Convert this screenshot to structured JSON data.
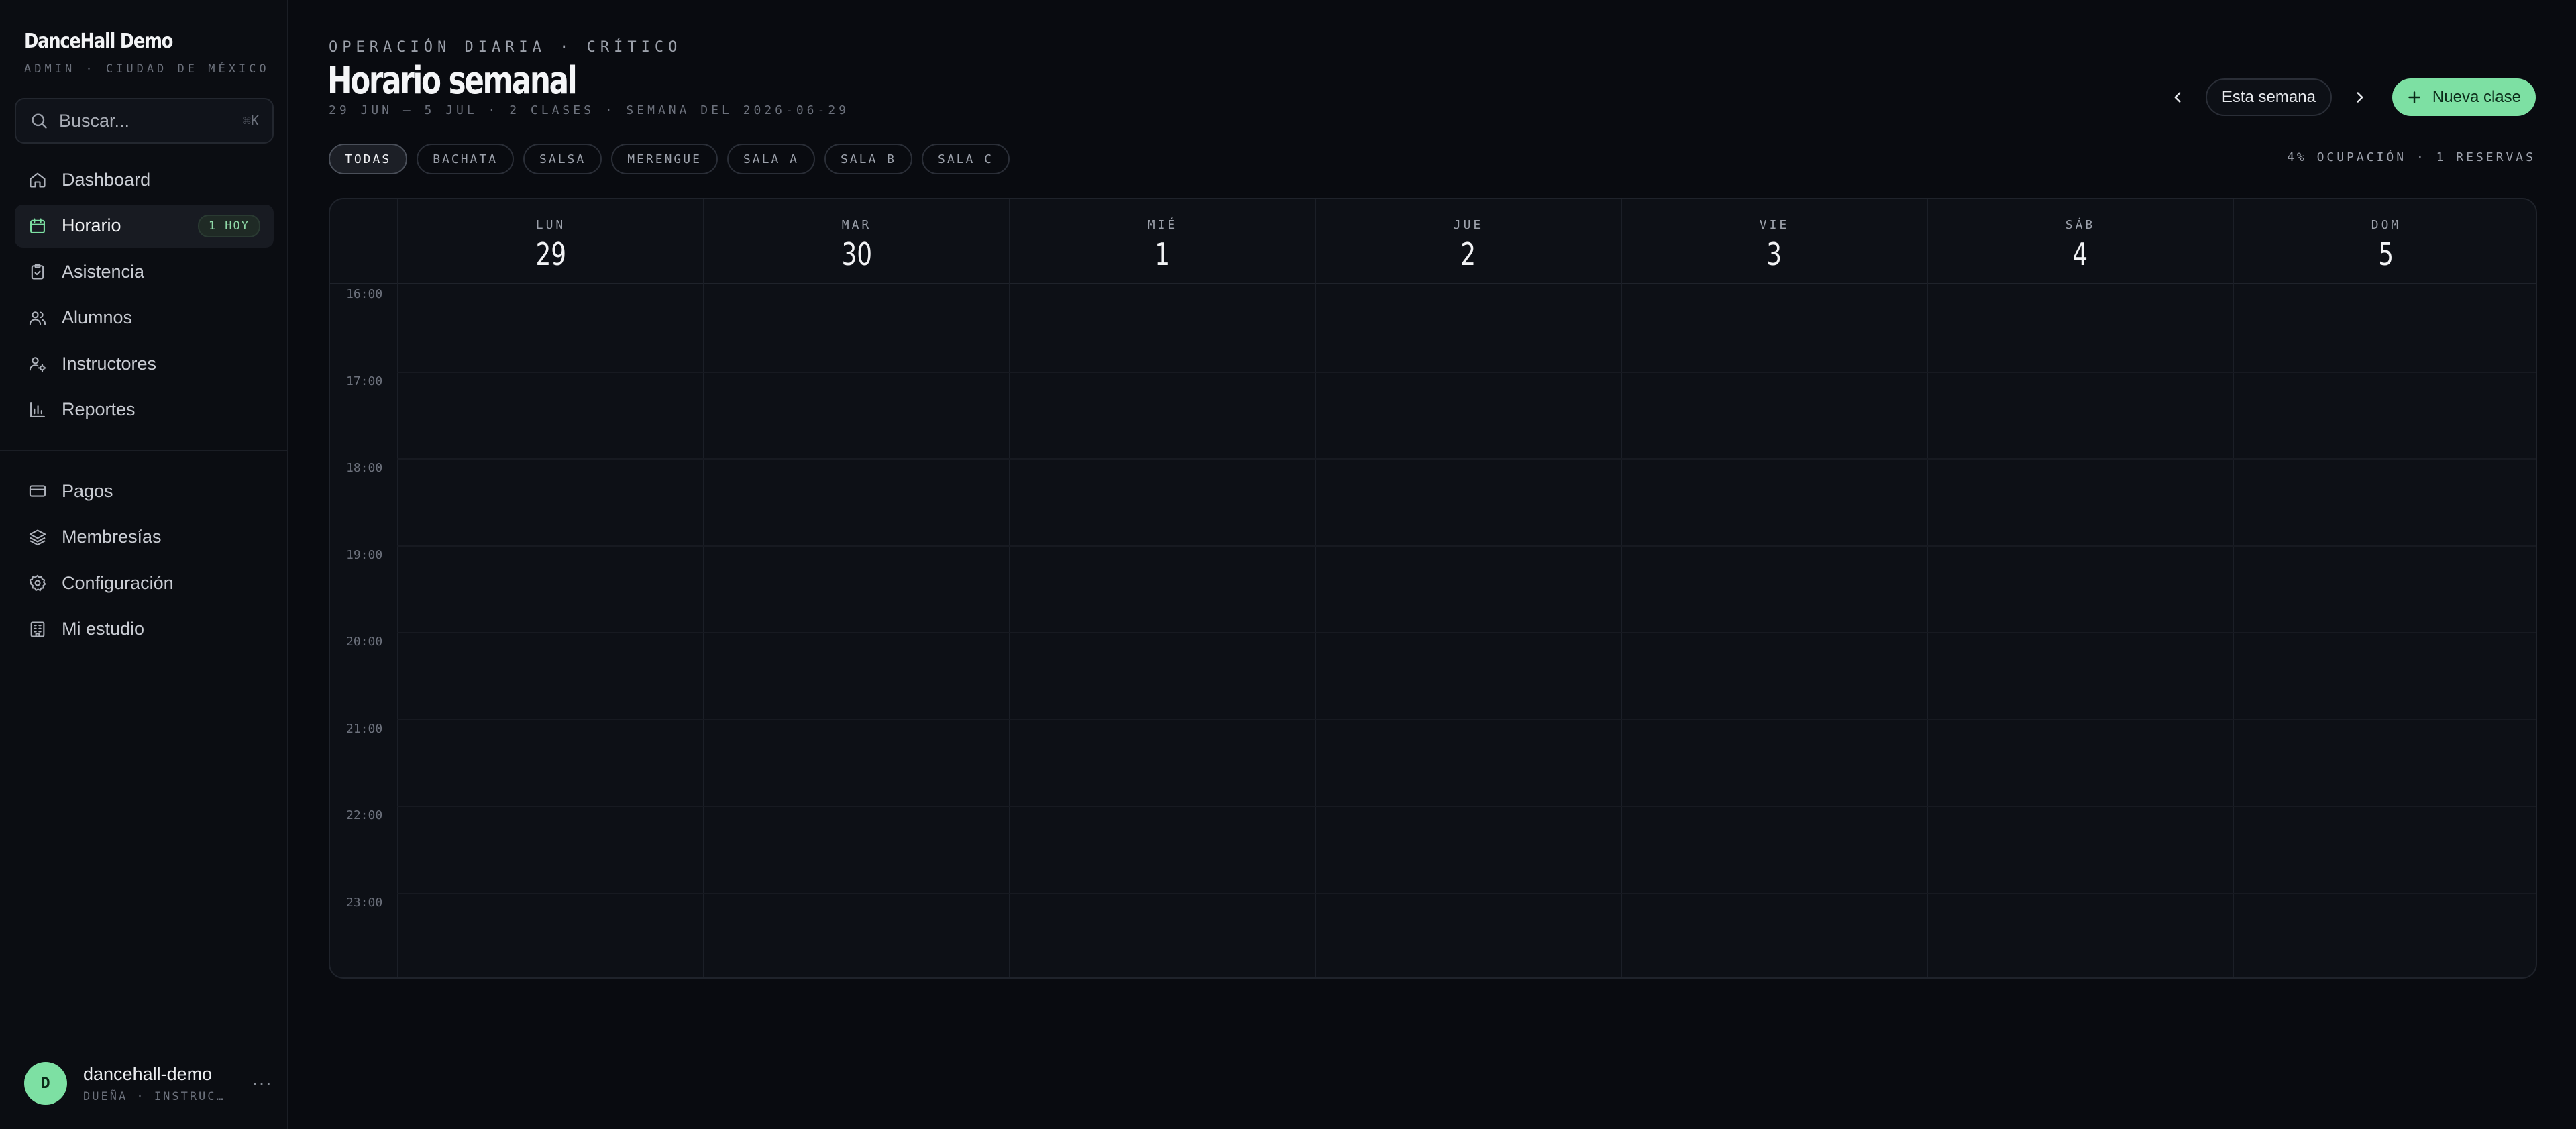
{
  "sidebar": {
    "brand": "DanceHall Demo",
    "brand_sub": "ADMIN · CIUDAD DE MÉXICO",
    "search_placeholder": "Buscar...",
    "search_shortcut": "⌘K",
    "nav_main": [
      {
        "label": "Dashboard",
        "icon": "home-icon"
      },
      {
        "label": "Horario",
        "icon": "calendar-icon",
        "badge": "1 HOY",
        "active": true
      },
      {
        "label": "Asistencia",
        "icon": "clipboard-check-icon"
      },
      {
        "label": "Alumnos",
        "icon": "users-icon"
      },
      {
        "label": "Instructores",
        "icon": "user-cog-icon"
      },
      {
        "label": "Reportes",
        "icon": "bar-chart-icon"
      }
    ],
    "nav_secondary": [
      {
        "label": "Pagos",
        "icon": "credit-card-icon"
      },
      {
        "label": "Membresías",
        "icon": "layers-icon"
      },
      {
        "label": "Configuración",
        "icon": "gear-icon"
      },
      {
        "label": "Mi estudio",
        "icon": "building-icon"
      }
    ],
    "user": {
      "initial": "D",
      "name": "dancehall-demo",
      "role": "DUEÑA · INSTRUC…",
      "more": "···"
    }
  },
  "header": {
    "eyebrow": "OPERACIÓN DIARIA · CRÍTICO",
    "title": "Horario semanal",
    "meta": "29 JUN – 5 JUL · 2 CLASES · SEMANA DEL 2026-06-29",
    "week_button": "Esta semana",
    "new_button": "Nueva clase"
  },
  "filters": [
    {
      "label": "TODAS",
      "active": true
    },
    {
      "label": "BACHATA"
    },
    {
      "label": "SALSA"
    },
    {
      "label": "MERENGUE"
    },
    {
      "label": "SALA A"
    },
    {
      "label": "SALA B"
    },
    {
      "label": "SALA C"
    }
  ],
  "occupancy": "4% OCUPACIÓN · 1 RESERVAS",
  "calendar": {
    "days": [
      {
        "name": "LUN",
        "num": "29"
      },
      {
        "name": "MAR",
        "num": "30"
      },
      {
        "name": "MIÉ",
        "num": "1"
      },
      {
        "name": "JUE",
        "num": "2"
      },
      {
        "name": "VIE",
        "num": "3"
      },
      {
        "name": "SÁB",
        "num": "4"
      },
      {
        "name": "DOM",
        "num": "5"
      }
    ],
    "hours": [
      "16:00",
      "17:00",
      "18:00",
      "19:00",
      "20:00",
      "21:00",
      "22:00",
      "23:00"
    ]
  },
  "colors": {
    "accent": "#7de0a3",
    "background": "#090b10",
    "sidebar": "#0b0d12"
  }
}
